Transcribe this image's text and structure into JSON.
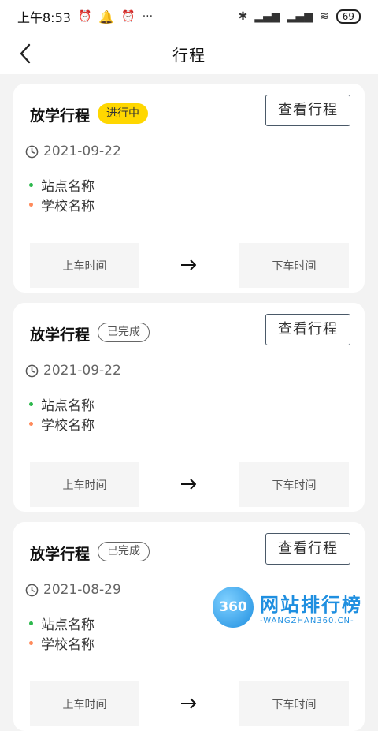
{
  "status_bar": {
    "time": "上午8:53",
    "icons": [
      "alarm-icon",
      "qq-icon",
      "alarm-icon",
      "more-dots-icon"
    ],
    "more": "···",
    "right_icons": [
      "bluetooth-icon",
      "signal-icon",
      "signal-icon",
      "wifi-icon"
    ],
    "battery": "69"
  },
  "nav": {
    "title": "行程",
    "back_icon": "back-arrow-icon"
  },
  "trips": [
    {
      "title": "放学行程",
      "status": "进行中",
      "status_type": "active",
      "button": "查看行程",
      "date": "2021-09-22",
      "stop_from": "站点名称",
      "stop_to": "学校名称",
      "board_label": "上车时间",
      "alight_label": "下车时间"
    },
    {
      "title": "放学行程",
      "status": "已完成",
      "status_type": "done",
      "button": "查看行程",
      "date": "2021-09-22",
      "stop_from": "站点名称",
      "stop_to": "学校名称",
      "board_label": "上车时间",
      "alight_label": "下车时间"
    },
    {
      "title": "放学行程",
      "status": "已完成",
      "status_type": "done",
      "button": "查看行程",
      "date": "2021-08-29",
      "stop_from": "站点名称",
      "stop_to": "学校名称",
      "board_label": "上车时间",
      "alight_label": "下车时间"
    }
  ],
  "watermark": {
    "logo": "360",
    "cn": "网站排行榜",
    "en": "-WANGZHAN360.CN-"
  },
  "colors": {
    "accent_yellow": "#ffd700",
    "dot_green": "#2db84d",
    "dot_orange": "#ff8a5b",
    "button_border": "#4a5968"
  }
}
